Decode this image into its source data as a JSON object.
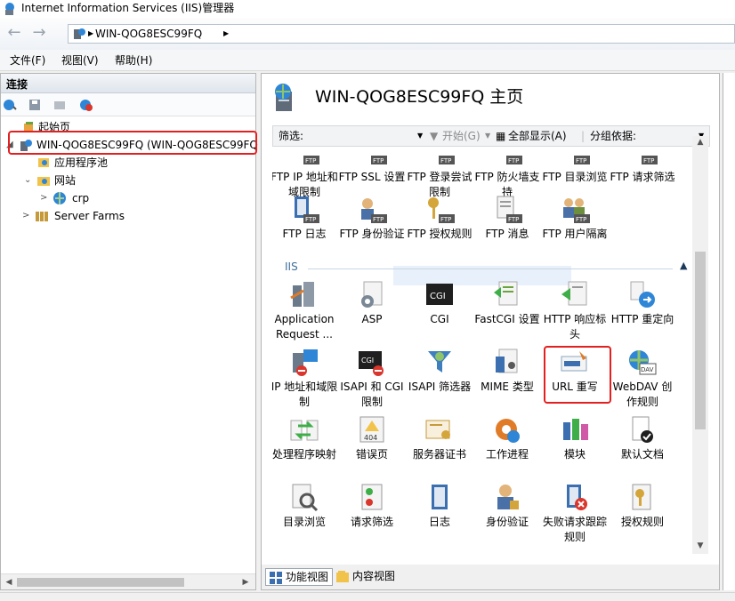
{
  "window": {
    "title": "Internet Information Services (IIS)管理器"
  },
  "address": {
    "path": "WIN-QOG8ESC99FQ"
  },
  "menu": [
    "文件(F)",
    "视图(V)",
    "帮助(H)"
  ],
  "connections": {
    "header": "连接",
    "tree": {
      "start_page": "起始页",
      "server": "WIN-QOG8ESC99FQ (WIN-QOG8ESC99FQ",
      "app_pools": "应用程序池",
      "sites": "网站",
      "site_crp": "crp",
      "server_farms": "Server Farms"
    }
  },
  "main": {
    "title": "WIN-QOG8ESC99FQ 主页",
    "filter": {
      "label": "筛选:",
      "start": "开始(G)",
      "show_all": "全部显示(A)",
      "group_by": "分组依据:"
    },
    "ftp_row1": [
      "FTP IP 地址和域限制",
      "FTP SSL 设置",
      "FTP 登录尝试限制",
      "FTP 防火墙支持",
      "FTP 目录浏览",
      "FTP 请求筛选"
    ],
    "ftp_row2": [
      "FTP 日志",
      "FTP 身份验证",
      "FTP 授权规则",
      "FTP 消息",
      "FTP 用户隔离"
    ],
    "group_iis": "IIS",
    "iis_row1": [
      "Application Request ...",
      "ASP",
      "CGI",
      "FastCGI 设置",
      "HTTP 响应标头",
      "HTTP 重定向"
    ],
    "iis_row2": [
      "IP 地址和域限制",
      "ISAPI 和 CGI 限制",
      "ISAPI 筛选器",
      "MIME 类型",
      "URL 重写",
      "WebDAV 创作规则"
    ],
    "iis_row3": [
      "处理程序映射",
      "错误页",
      "服务器证书",
      "工作进程",
      "模块",
      "默认文档"
    ],
    "iis_row4": [
      "目录浏览",
      "请求筛选",
      "日志",
      "身份验证",
      "失败请求跟踪规则",
      "授权规则"
    ],
    "tabs": {
      "features": "功能视图",
      "content": "内容视图"
    }
  },
  "colors": {
    "highlight": "#e32020",
    "accent": "#1b6fc2"
  }
}
